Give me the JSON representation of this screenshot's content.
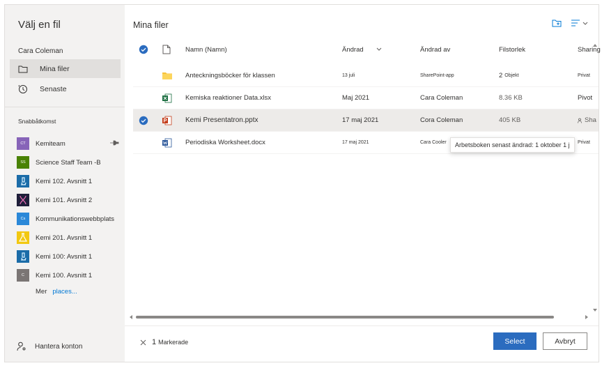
{
  "sidebar": {
    "title": "Välj en fil",
    "user": "Cara Coleman",
    "nav": [
      {
        "label": "Mina filer",
        "icon": "folder-icon",
        "selected": true
      },
      {
        "label": "Senaste",
        "icon": "history-icon",
        "selected": false
      }
    ],
    "quick_access_label": "Snabbåtkomst",
    "quick_access": [
      {
        "label": "Kemiteam",
        "tile": "CT",
        "color": "#8764b8",
        "pinned": true
      },
      {
        "label": "Science Staff Team -B",
        "tile": "SS",
        "color": "#498205"
      },
      {
        "label": "Kemi 102. Avsnitt 1",
        "tile": "",
        "color": "#1b6ca8"
      },
      {
        "label": "Kemi 101. Avsnitt 2",
        "tile": "",
        "color": "#1f1f3a"
      },
      {
        "label": "Kommunikationswebbplats",
        "tile": "Cs",
        "color": "#2b88d8"
      },
      {
        "label": "Kemi 201. Avsnitt 1",
        "tile": "",
        "color": "#f2c811"
      },
      {
        "label": "Kemi 100: Avsnitt 1",
        "tile": "",
        "color": "#1b6ca8"
      },
      {
        "label": "Kemi 100. Avsnitt 1",
        "tile": "C",
        "color": "#7a7574"
      }
    ],
    "more_label": "Mer",
    "more_link": "places...",
    "manage_label": "Hantera konton"
  },
  "main": {
    "title": "Mina filer",
    "columns": {
      "name": "Namn (Namn)",
      "modified": "Ändrad",
      "modified_by": "Ändrad av",
      "size": "Filstorlek",
      "sharing": "Sharing"
    },
    "rows": [
      {
        "type": "folder",
        "name": "Anteckningsböcker för klassen",
        "modified": "13 juli",
        "modified_by": "SharePoint-app",
        "size_num": "2",
        "size_unit": "Objekt",
        "sharing": "Privat",
        "selected": false
      },
      {
        "type": "excel",
        "name": "Kemiska reaktioner Data.xlsx",
        "modified": "Maj 2021",
        "modified_by": "Cara Coleman",
        "size": "8.36 KB",
        "sharing": "Pivot",
        "selected": false
      },
      {
        "type": "powerpoint",
        "name": "Kemi Presentatron.pptx",
        "modified": "17 maj 2021",
        "modified_by": "Cora Coleman",
        "size": "405 KB",
        "sharing": "Sha",
        "selected": true
      },
      {
        "type": "word",
        "name": "Periodiska Worksheet.docx",
        "modified": "17 maj 2021",
        "modified_by": "Cara Cooler",
        "size": "",
        "sharing": "Privat",
        "selected": false
      }
    ],
    "tooltip": "Arbetsboken senast ändrad: 1 oktober 1 j"
  },
  "footer": {
    "selected_count": "1",
    "selected_label": "Markerade",
    "select_button": "Select",
    "cancel_button": "Avbryt"
  },
  "colors": {
    "accent": "#0078d4",
    "primary_button": "#2b6cbf",
    "folder": "#f8c23a",
    "excel": "#1d6f42",
    "powerpoint": "#c43e1c",
    "word": "#2b579a"
  }
}
